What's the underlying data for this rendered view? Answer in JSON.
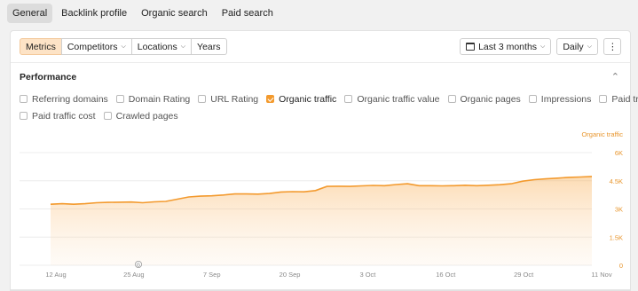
{
  "top_tabs": [
    {
      "label": "General",
      "active": true
    },
    {
      "label": "Backlink profile",
      "active": false
    },
    {
      "label": "Organic search",
      "active": false
    },
    {
      "label": "Paid search",
      "active": false
    }
  ],
  "toolbar": {
    "segment": [
      {
        "label": "Metrics",
        "active": true,
        "dropdown": false
      },
      {
        "label": "Competitors",
        "active": false,
        "dropdown": true
      },
      {
        "label": "Locations",
        "active": false,
        "dropdown": true
      },
      {
        "label": "Years",
        "active": false,
        "dropdown": false
      }
    ],
    "date_range": "Last 3 months",
    "granularity": "Daily"
  },
  "performance": {
    "title": "Performance",
    "metrics": [
      {
        "label": "Referring domains",
        "checked": false
      },
      {
        "label": "Domain Rating",
        "checked": false
      },
      {
        "label": "URL Rating",
        "checked": false
      },
      {
        "label": "Organic traffic",
        "checked": true
      },
      {
        "label": "Organic traffic value",
        "checked": false
      },
      {
        "label": "Organic pages",
        "checked": false
      },
      {
        "label": "Impressions",
        "checked": false
      },
      {
        "label": "Paid traffic",
        "checked": false
      },
      {
        "label": "Paid traffic cost",
        "checked": false
      },
      {
        "label": "Crawled pages",
        "checked": false
      }
    ]
  },
  "colors": {
    "accent": "#f39a2e",
    "accent_text": "#e8962e",
    "active_bg": "#fde3c6"
  },
  "chart_data": {
    "type": "area",
    "series": [
      {
        "name": "Organic traffic",
        "x": [
          "Aug 10",
          "Aug 12",
          "Aug 14",
          "Aug 16",
          "Aug 18",
          "Aug 20",
          "Aug 22",
          "Aug 24",
          "Aug 26",
          "Aug 28",
          "Aug 30",
          "Sep 1",
          "Sep 3",
          "Sep 5",
          "Sep 7",
          "Sep 9",
          "Sep 11",
          "Sep 13",
          "Sep 15",
          "Sep 17",
          "Sep 19",
          "Sep 21",
          "Sep 23",
          "Sep 25",
          "Sep 27",
          "Sep 29",
          "Oct 1",
          "Oct 3",
          "Oct 5",
          "Oct 7",
          "Oct 9",
          "Oct 11",
          "Oct 13",
          "Oct 15",
          "Oct 17",
          "Oct 19",
          "Oct 21",
          "Oct 23",
          "Oct 25",
          "Oct 27",
          "Oct 29",
          "Oct 31",
          "Nov 2",
          "Nov 4",
          "Nov 6",
          "Nov 8",
          "Nov 10",
          "Nov 12"
        ],
        "values": [
          3250,
          3280,
          3250,
          3280,
          3330,
          3350,
          3360,
          3370,
          3330,
          3380,
          3400,
          3520,
          3640,
          3680,
          3700,
          3740,
          3800,
          3800,
          3790,
          3820,
          3900,
          3920,
          3910,
          3980,
          4200,
          4210,
          4200,
          4230,
          4250,
          4240,
          4300,
          4340,
          4240,
          4240,
          4230,
          4240,
          4260,
          4240,
          4260,
          4290,
          4340,
          4480,
          4560,
          4600,
          4640,
          4680,
          4700,
          4730
        ]
      }
    ],
    "x_tick_labels": [
      "12 Aug",
      "25 Aug",
      "7 Sep",
      "20 Sep",
      "3 Oct",
      "16 Oct",
      "29 Oct",
      "11 Nov"
    ],
    "y_tick_labels": [
      "0",
      "1.5K",
      "3K",
      "4.5K",
      "6K"
    ],
    "ylim": [
      0,
      6000
    ],
    "y_axis_title": "Organic traffic",
    "grid": true,
    "marker_label": "G"
  }
}
